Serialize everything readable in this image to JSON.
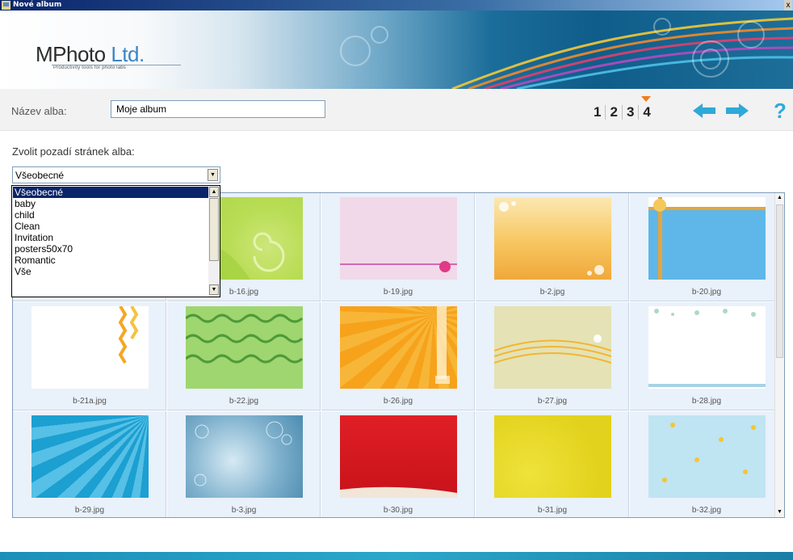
{
  "window": {
    "title": "Nové album",
    "close_label": "x"
  },
  "logo": {
    "main": "MPhoto",
    "suffix": "Ltd.",
    "tagline": "Productivity tools for photo labs"
  },
  "toolbar": {
    "album_name_label": "Název alba:",
    "album_name_value": "Moje album",
    "steps": [
      "1",
      "2",
      "3",
      "4"
    ],
    "active_step": "4",
    "help_label": "?"
  },
  "background": {
    "label": "Zvolit pozadí stránek alba:",
    "selected": "Všeobecné",
    "options": [
      "Všeobecné",
      "baby",
      "child",
      "Clean",
      "Invitation",
      "posters50x70",
      "Romantic",
      "Vše"
    ]
  },
  "grid": {
    "items": [
      {
        "name": "",
        "visible_caption": false
      },
      {
        "name": "b-16.jpg"
      },
      {
        "name": "b-19.jpg"
      },
      {
        "name": "b-2.jpg"
      },
      {
        "name": "b-20.jpg"
      },
      {
        "name": "b-21a.jpg"
      },
      {
        "name": "b-22.jpg"
      },
      {
        "name": "b-26.jpg"
      },
      {
        "name": "b-27.jpg"
      },
      {
        "name": "b-28.jpg"
      },
      {
        "name": "b-29.jpg"
      },
      {
        "name": "b-3.jpg"
      },
      {
        "name": "b-30.jpg"
      },
      {
        "name": "b-31.jpg"
      },
      {
        "name": "b-32.jpg"
      }
    ]
  },
  "colors": {
    "accent_orange": "#f07d1a",
    "arrow_blue": "#2fa9d8",
    "selection": "#0a246a"
  }
}
